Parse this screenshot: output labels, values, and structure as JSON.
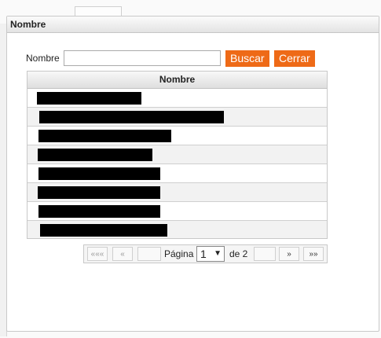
{
  "dialog": {
    "title": "Nombre"
  },
  "search": {
    "label": "Nombre",
    "value": "",
    "placeholder": "",
    "buscar_label": "Buscar",
    "cerrar_label": "Cerrar"
  },
  "grid": {
    "column_header": "Nombre",
    "rows": [
      {
        "name": "[redacted]"
      },
      {
        "name": "[redacted]"
      },
      {
        "name": "[redacted]"
      },
      {
        "name": "[redacted]"
      },
      {
        "name": "[redacted]"
      },
      {
        "name": "[redacted]"
      },
      {
        "name": "[redacted]"
      },
      {
        "name": "[redacted]"
      }
    ]
  },
  "pager": {
    "first_label": "«««",
    "prev_label": "«",
    "page_label": "Página",
    "current_page": "1",
    "of_label": "de 2",
    "next_label": "»",
    "last_label": "»»"
  },
  "colors": {
    "accent": "#ee6a17",
    "redaction": "#000000"
  }
}
